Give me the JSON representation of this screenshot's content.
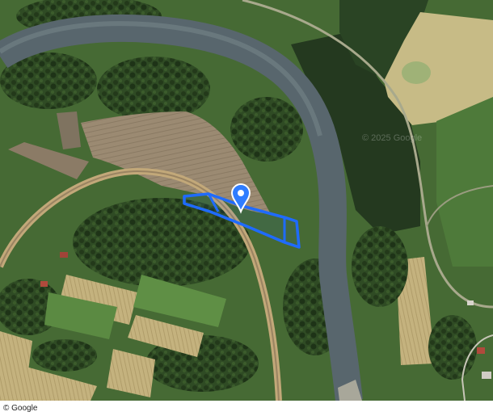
{
  "map": {
    "type": "satellite",
    "attribution": "© Google",
    "watermark": "© 2025 Google",
    "overlay_color": "#1f6bff",
    "pin_color": "#2f7dff",
    "river_color": "#58666d",
    "field_color": "#b29a6e",
    "meadow_color": "#cbbf86"
  }
}
